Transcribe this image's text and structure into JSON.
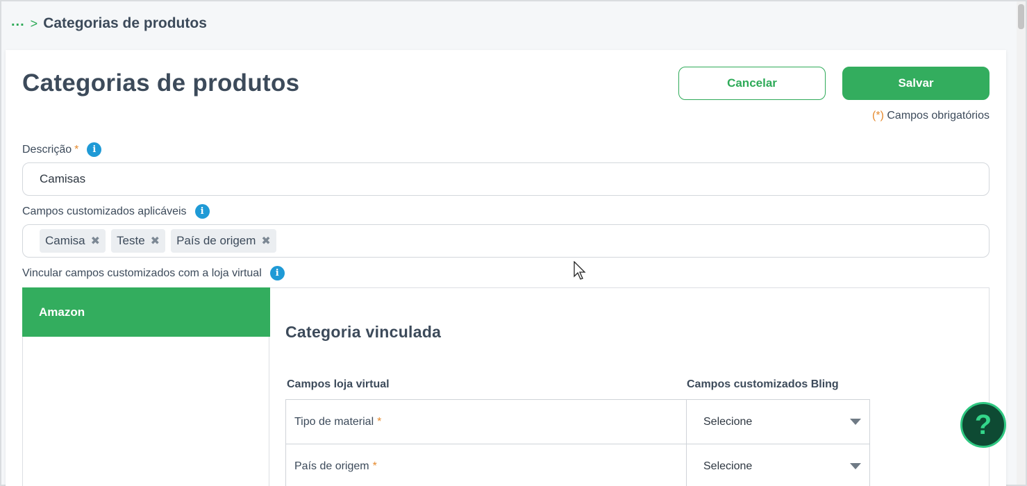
{
  "breadcrumb": {
    "ellipsis": "...",
    "separator": ">",
    "current": "Categorias de produtos"
  },
  "page": {
    "title": "Categorias de produtos"
  },
  "actions": {
    "cancel_label": "Cancelar",
    "save_label": "Salvar"
  },
  "required_note": {
    "star": "(*)",
    "text": " Campos obrigatórios"
  },
  "description": {
    "label": "Descrição",
    "required_mark": "*",
    "value": "Camisas"
  },
  "custom_fields": {
    "label": "Campos customizados aplicáveis",
    "tags": [
      {
        "label": "Camisa"
      },
      {
        "label": "Teste"
      },
      {
        "label": "País de origem"
      }
    ],
    "remove_glyph": "✖"
  },
  "link_section": {
    "label": "Vincular campos customizados com a loja virtual",
    "stores": [
      {
        "label": "Amazon",
        "active": true
      }
    ],
    "title": "Categoria vinculada",
    "col_store_fields": "Campos loja virtual",
    "col_bling_fields": "Campos customizados Bling",
    "rows": [
      {
        "field": "Tipo de material",
        "required_mark": "*",
        "selected": "Selecione"
      },
      {
        "field": "País de origem",
        "required_mark": "*",
        "selected": "Selecione"
      }
    ]
  },
  "help": {
    "glyph": "?"
  },
  "colors": {
    "accent": "#33ad5e",
    "info": "#1f9ad6",
    "required": "#e58a2e",
    "help_bg": "#0e4a33"
  }
}
